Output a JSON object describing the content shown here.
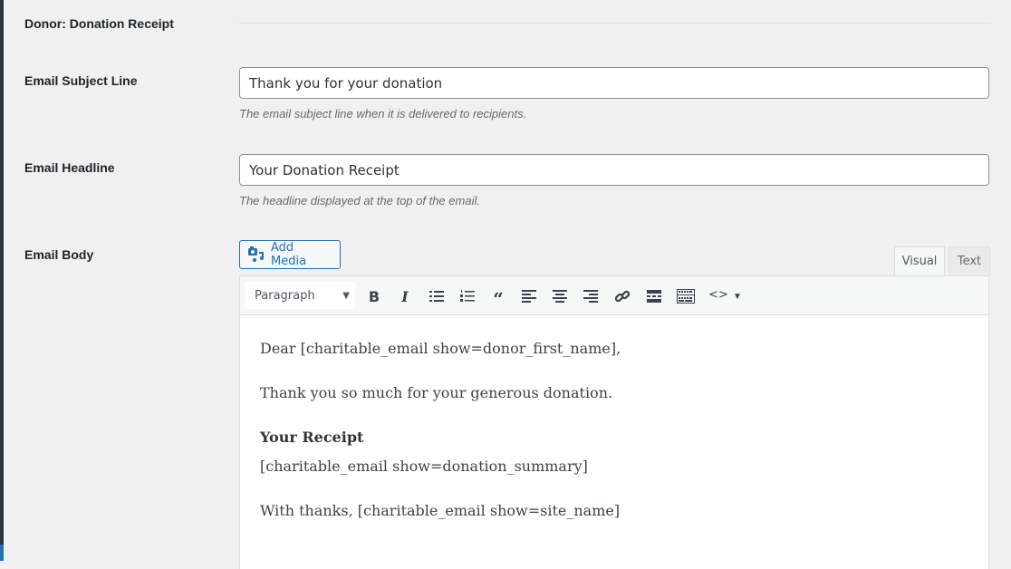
{
  "section": {
    "title": "Donor: Donation Receipt"
  },
  "fields": {
    "subject": {
      "label": "Email Subject Line",
      "value": "Thank you for your donation",
      "description": "The email subject line when it is delivered to recipients."
    },
    "headline": {
      "label": "Email Headline",
      "value": "Your Donation Receipt",
      "description": "The headline displayed at the top of the email."
    },
    "body": {
      "label": "Email Body"
    }
  },
  "editor": {
    "add_media_label": "Add Media",
    "tabs": {
      "visual": "Visual",
      "text": "Text"
    },
    "active_tab": "Visual",
    "format_select": "Paragraph",
    "toolbar_icons": [
      "bold-icon",
      "italic-icon",
      "bullet-list-icon",
      "numbered-list-icon",
      "blockquote-icon",
      "align-left-icon",
      "align-center-icon",
      "align-right-icon",
      "link-icon",
      "read-more-icon",
      "toolbar-toggle-icon",
      "code-icon",
      "more-dropdown-icon"
    ],
    "content": {
      "line1": "Dear [charitable_email show=donor_first_name],",
      "line2": "Thank you so much for your generous donation.",
      "heading": "Your Receipt",
      "line3": "[charitable_email show=donation_summary]",
      "line4": "With thanks, [charitable_email show=site_name]"
    }
  },
  "colors": {
    "accent": "#2271b1",
    "background": "#f0f0f1"
  }
}
